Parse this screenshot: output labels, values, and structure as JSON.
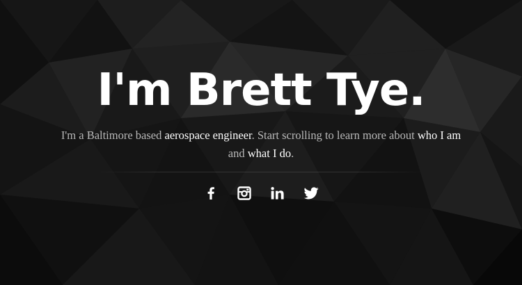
{
  "hero": {
    "headline": "I'm Brett Tye.",
    "intro": {
      "part1": "I'm a Baltimore based ",
      "highlight_profession": "aerospace engineer",
      "part2": ". Start scrolling to learn more about ",
      "link_who": "who I am",
      "part3": " and ",
      "link_what": "what I do",
      "part4": "."
    }
  },
  "social": [
    {
      "icon": "facebook-icon",
      "name": "Facebook"
    },
    {
      "icon": "instagram-icon",
      "name": "Instagram"
    },
    {
      "icon": "linkedin-icon",
      "name": "LinkedIn"
    },
    {
      "icon": "twitter-icon",
      "name": "Twitter"
    }
  ],
  "colors": {
    "background": "#0b0b0b",
    "headline": "#ffffff",
    "intro_text": "#b9b9b9",
    "intro_highlight": "#ffffff",
    "icons": "#ffffff"
  }
}
